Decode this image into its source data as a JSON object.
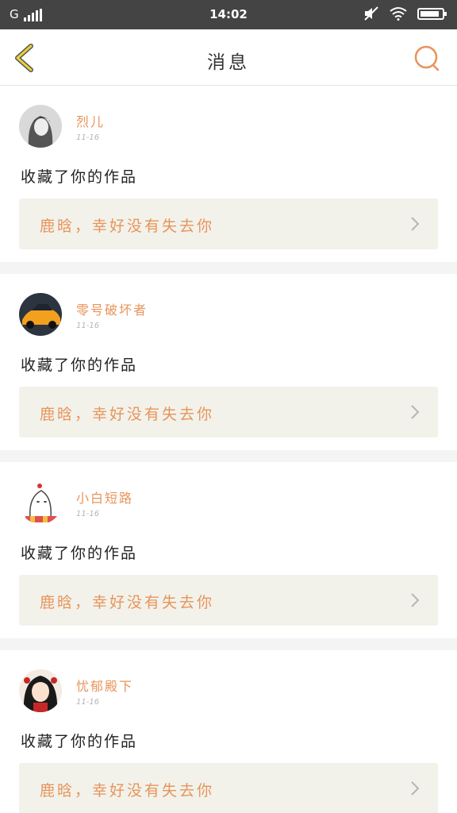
{
  "status_bar": {
    "carrier": "G",
    "time": "14:02",
    "battery_level": 0.9,
    "icons": [
      "signal-icon",
      "mute-icon",
      "wifi-icon",
      "battery-icon"
    ]
  },
  "header": {
    "title": "消息",
    "back_icon": "chevron-left-icon",
    "search_icon": "search-icon"
  },
  "colors": {
    "accent": "#e8945a",
    "back_icon": "#e0b400",
    "box_bg": "#f2f2eb"
  },
  "messages": [
    {
      "username": "烈儿",
      "date": "11-16",
      "action": "收藏了你的作品",
      "work_title": "鹿晗，幸好没有失去你"
    },
    {
      "username": "零号破坏者",
      "date": "11-16",
      "action": "收藏了你的作品",
      "work_title": "鹿晗，幸好没有失去你"
    },
    {
      "username": "小白短路",
      "date": "11-16",
      "action": "收藏了你的作品",
      "work_title": "鹿晗，幸好没有失去你"
    },
    {
      "username": "忧郁殿下",
      "date": "11-16",
      "action": "收藏了你的作品",
      "work_title": "鹿晗，幸好没有失去你"
    }
  ]
}
